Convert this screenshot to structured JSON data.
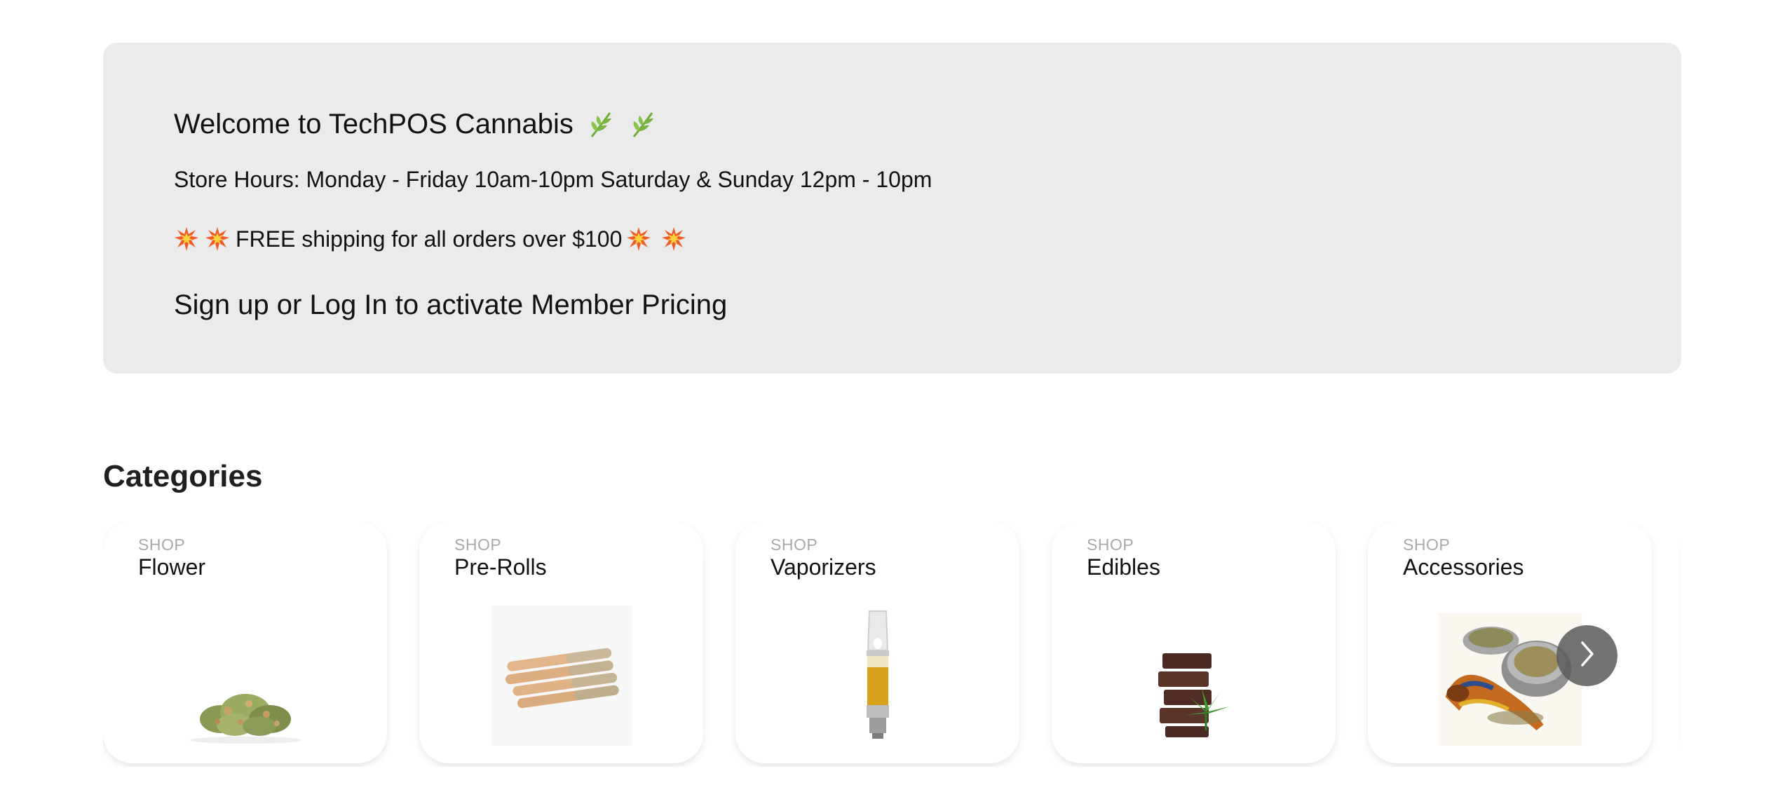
{
  "banner": {
    "welcome": "Welcome to TechPOS Cannabis",
    "welcome_icons": [
      "herb-icon",
      "herb-icon"
    ],
    "hours": "Store Hours: Monday - Friday 10am-10pm Saturday & Sunday 12pm - 10pm",
    "shipping": "FREE shipping for all orders over $100",
    "shipping_icons": [
      "collision-icon",
      "collision-icon",
      "collision-icon",
      "collision-icon"
    ],
    "member": "Sign up or Log In to activate Member Pricing",
    "background": "#ebebeb"
  },
  "categories": {
    "title": "Categories",
    "items": [
      {
        "eyebrow": "SHOP",
        "label": "Flower",
        "image": "flower-bud-image"
      },
      {
        "eyebrow": "SHOP",
        "label": "Pre-Rolls",
        "image": "pre-rolls-image"
      },
      {
        "eyebrow": "SHOP",
        "label": "Vaporizers",
        "image": "vape-cartridge-image"
      },
      {
        "eyebrow": "SHOP",
        "label": "Edibles",
        "image": "chocolate-edible-image"
      },
      {
        "eyebrow": "SHOP",
        "label": "Accessories",
        "image": "pipe-grinder-image"
      }
    ],
    "next_icon": "chevron-right-icon"
  }
}
